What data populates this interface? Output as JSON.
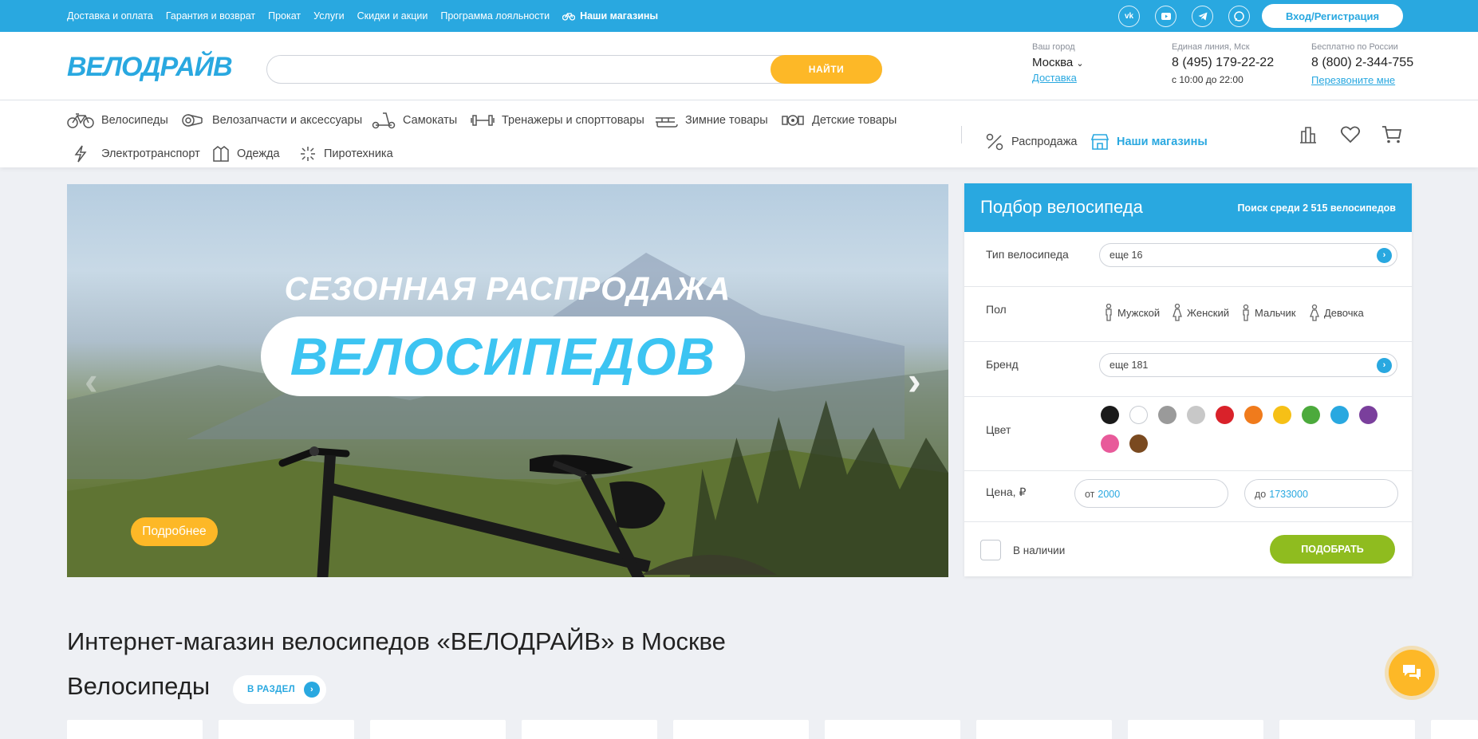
{
  "topbar": {
    "links": [
      "Доставка и оплата",
      "Гарантия и возврат",
      "Прокат",
      "Услуги",
      "Скидки и акции",
      "Программа лояльности"
    ],
    "shops_link": "Наши магазины",
    "socials": [
      "vk-icon",
      "youtube-icon",
      "telegram-icon",
      "chat-icon"
    ],
    "login_label": "Вход/Регистрация"
  },
  "header": {
    "logo": "ВЕЛОДРАЙВ",
    "search_placeholder": "",
    "search_button": "НАЙТИ",
    "city": {
      "label": "Ваш город",
      "value": "Москва",
      "link": "Доставка"
    },
    "line_msk": {
      "label": "Единая линия, Мск",
      "phone": "8 (495) 179-22-22",
      "hours": "с 10:00 до 22:00"
    },
    "line_ru": {
      "label": "Бесплатно по России",
      "phone": "8 (800) 2-344-755",
      "link": "Перезвоните мне"
    }
  },
  "nav": {
    "items": [
      "Велосипеды",
      "Велозапчасти и аксессуары",
      "Самокаты",
      "Тренажеры и спорттовары",
      "Зимние товары",
      "Детские товары",
      "Электротранспорт",
      "Одежда",
      "Пиротехника"
    ],
    "sale": "Распродажа",
    "shops": "Наши магазины",
    "tools": [
      "compare-icon",
      "favorites-icon",
      "cart-icon"
    ]
  },
  "banner": {
    "line1": "СЕЗОННАЯ РАСПРОДАЖА",
    "line2": "ВЕЛОСИПЕДОВ",
    "more_button": "Подробнее"
  },
  "filter": {
    "title": "Подбор велосипеда",
    "count": "Поиск среди 2 515 велосипедов",
    "type_label": "Тип велосипеда",
    "type_value": "еще 16",
    "gender_label": "Пол",
    "genders": [
      "Мужской",
      "Женский",
      "Мальчик",
      "Девочка"
    ],
    "brand_label": "Бренд",
    "brand_value": "еще 181",
    "color_label": "Цвет",
    "colors": [
      "#1a1a1a",
      "#ffffff",
      "#9a9a9a",
      "#c8c8c8",
      "#d9222a",
      "#f07b1c",
      "#f6c016",
      "#4caa3c",
      "#29a8e0",
      "#7a3f9c",
      "#e85a9a",
      "#7a4a20"
    ],
    "price_label": "Цена, ₽",
    "price_from_label": "от",
    "price_from": "2000",
    "price_to_label": "до",
    "price_to": "1733000",
    "in_stock": "В наличии",
    "pick_button": "ПОДОБРАТЬ"
  },
  "content": {
    "heading": "Интернет-магазин велосипедов «ВЕЛОДРАЙВ» в Москве",
    "section_title": "Велосипеды",
    "section_button": "В РАЗДЕЛ"
  }
}
